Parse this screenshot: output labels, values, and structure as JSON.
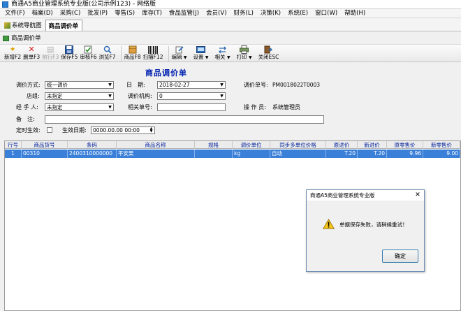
{
  "window": {
    "title": "商通A5商业管理系统专业版(公司示例123) - 网络版"
  },
  "menu": [
    "文件(F)",
    "档案(D)",
    "采购(C)",
    "批发(P)",
    "零售(S)",
    "库存(T)",
    "食品监管(J)",
    "会员(V)",
    "财务(L)",
    "决策(K)",
    "系统(E)",
    "窗口(W)",
    "帮助(H)"
  ],
  "tabs": [
    {
      "label": "系统导航图"
    },
    {
      "label": "商品调价单"
    }
  ],
  "window_label": "商品调价单",
  "toolbar": {
    "new": "新增F2",
    "delete": "删单F3",
    "prev": "前行F3",
    "save": "保存F5",
    "audit": "审核F6",
    "browse": "浏览F7",
    "goods": "商品F8",
    "scan": "扫描F12",
    "edit": "编辑",
    "settings": "设置",
    "related": "相关",
    "print": "打印",
    "close": "关闭ESC"
  },
  "form": {
    "title": "商品调价单",
    "method_label": "调价方式:",
    "method_value": "统一调价",
    "date_label": "日　期:",
    "date_value": "2018-02-27",
    "docno_label": "调价单号:",
    "docno_value": "PM0018022T0003",
    "store_label": "店组:",
    "store_value": "未指定",
    "org_label": "调价机构:",
    "org_value": "0",
    "handler_label": "经 手 人:",
    "handler_value": "未指定",
    "refno_label": "相关单号:",
    "refno_value": "",
    "operator_label": "操 作 员:",
    "operator_value": "系统管理员",
    "remark_label": "备　注:",
    "remark_value": "",
    "scheduled_label": "定时生效:",
    "effective_label": "生效日期:",
    "effective_value": "0000.00.00 00:00"
  },
  "grid": {
    "columns": [
      "行号",
      "商品货号",
      "条码",
      "商品名称",
      "规格",
      "调价单位",
      "同步多单位价格",
      "原进价",
      "新进价",
      "原零售价",
      "新零售价"
    ],
    "rows": [
      [
        "1",
        "00310",
        "2400310000000",
        "平安果",
        "",
        "kg",
        "自动",
        "T.20",
        "T.20",
        "9.96",
        "9.00"
      ]
    ]
  },
  "dialog": {
    "title": "商通A5商业管理系统专业版",
    "message": "单据保存失败，请稍候重试！",
    "ok": "确定"
  }
}
